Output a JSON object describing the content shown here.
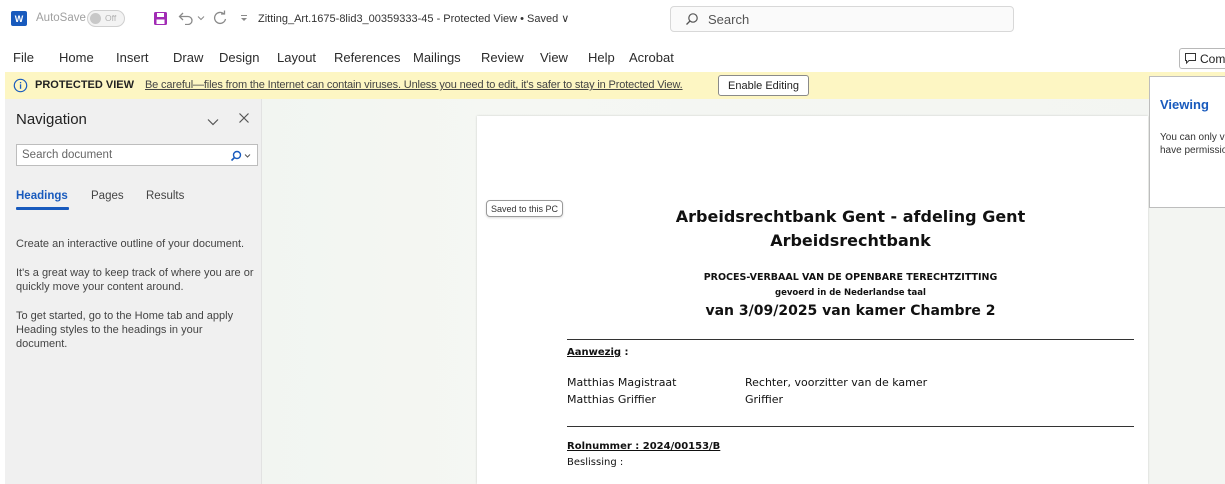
{
  "titlebar": {
    "app_icon_letter": "W",
    "autosave_label": "AutoSave",
    "autosave_state": "Off",
    "document_title": "Zitting_Art.1675-8lid3_00359333-45  -  Protected View • Saved ∨",
    "search_placeholder": "Search"
  },
  "ribbon": {
    "tabs": [
      "File",
      "Home",
      "Insert",
      "Draw",
      "Design",
      "Layout",
      "References",
      "Mailings",
      "Review",
      "View",
      "Help",
      "Acrobat"
    ],
    "comments_label": "Com"
  },
  "protected_view": {
    "label": "PROTECTED VIEW",
    "message": "Be careful—files from the Internet can contain viruses. Unless you need to edit, it's safer to stay in Protected View.",
    "button": "Enable Editing",
    "color": "#fdf6c3"
  },
  "navigation": {
    "title": "Navigation",
    "search_placeholder": "Search document",
    "tabs": [
      "Headings",
      "Pages",
      "Results"
    ],
    "active_tab": "Headings",
    "help_paragraphs": [
      "Create an interactive outline of your document.",
      "It's a great way to keep track of where you are or quickly move your content around.",
      "To get started, go to the Home tab and apply Heading styles to the headings in your document."
    ]
  },
  "document": {
    "saved_tooltip": "Saved to this PC",
    "court_line1": "Arbeidsrechtbank Gent - afdeling Gent",
    "court_line2": "Arbeidsrechtbank",
    "record_title": "PROCES-VERBAAL VAN DE OPENBARE TERECHTZITTING",
    "language_line": "gevoerd in de Nederlandse taal",
    "date_line": "van 3/09/2025 van kamer Chambre 2",
    "present_label": "Aanwezig",
    "present_suffix": " :",
    "attendees": [
      {
        "name": "Matthias Magistraat",
        "role": "Rechter, voorzitter van de kamer"
      },
      {
        "name": "Matthias Griffier",
        "role": "Griffier"
      }
    ],
    "roll_number": "Rolnummer : 2024/00153/B",
    "decision_label": "Beslissing :"
  },
  "viewing_panel": {
    "title": "Viewing",
    "description": "You can only view this document. You don't have permissions to edit."
  },
  "colors": {
    "accent": "#185abd",
    "protected_bar": "#fdf6c3"
  }
}
